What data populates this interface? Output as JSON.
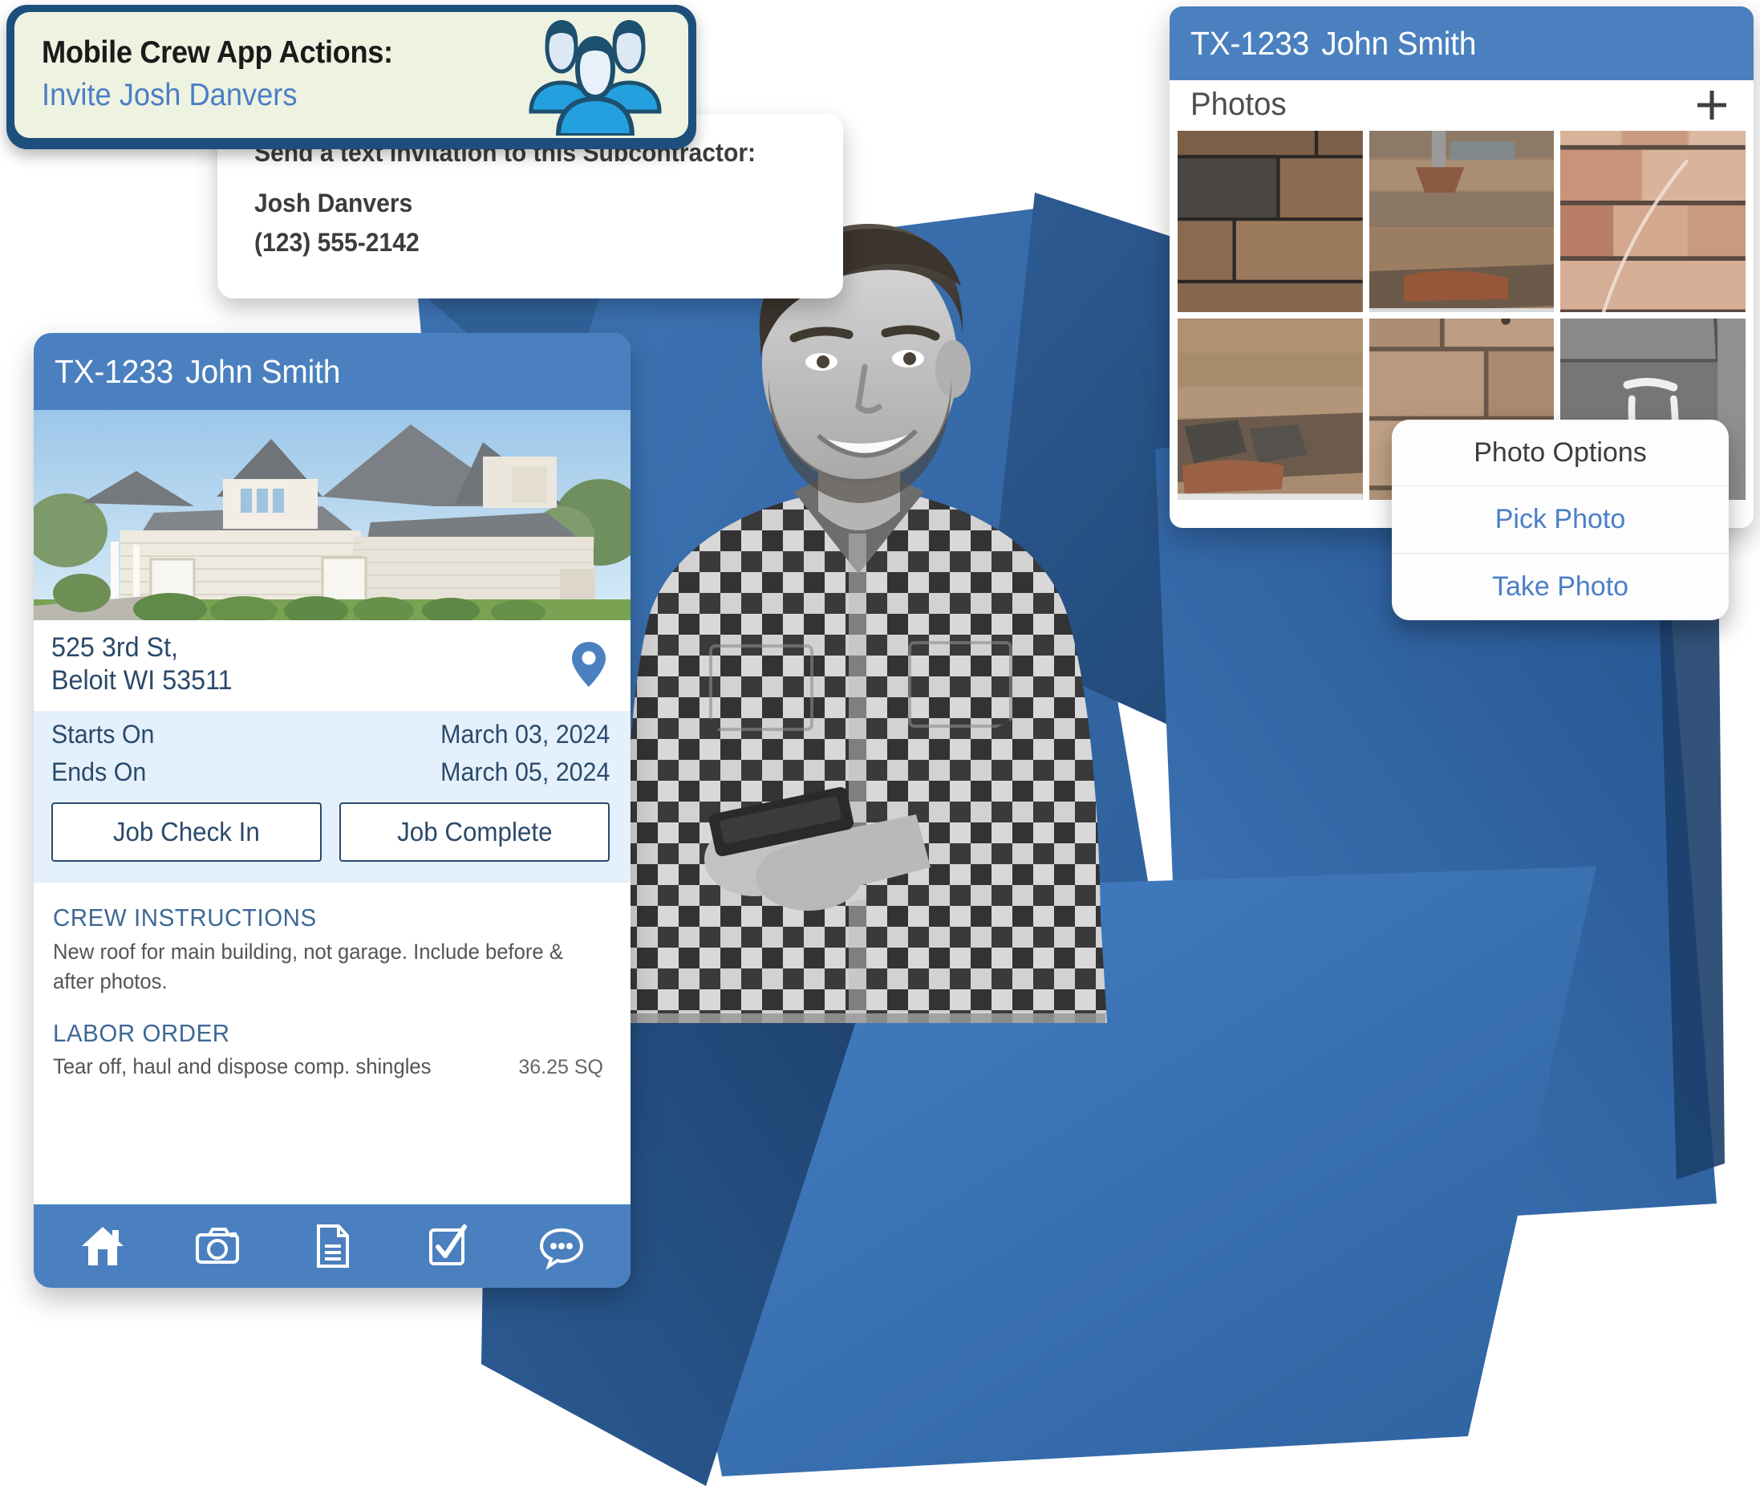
{
  "action_badge": {
    "title": "Mobile Crew App Actions:",
    "link": "Invite Josh Danvers",
    "icon": "crew-people-icon"
  },
  "invite_card": {
    "heading": "Send a text invitation to this Subcontractor:",
    "name": "Josh Danvers",
    "phone": "(123) 555-2142"
  },
  "job_card": {
    "header": {
      "job_id": "TX-1233",
      "customer": "John Smith"
    },
    "address": {
      "line1": "525 3rd St,",
      "line2": "Beloit WI 53511",
      "pin_icon": "map-pin-icon"
    },
    "dates": [
      {
        "label": "Starts On",
        "value": "March 03, 2024"
      },
      {
        "label": "Ends On",
        "value": "March 05, 2024"
      }
    ],
    "buttons": {
      "check_in": "Job Check In",
      "complete": "Job Complete"
    },
    "crew_instructions": {
      "title": "CREW INSTRUCTIONS",
      "body": "New roof for main building, not garage. Include before & after photos."
    },
    "labor_order": {
      "title": "LABOR ORDER",
      "items": [
        {
          "description": "Tear off, haul and dispose comp. shingles",
          "quantity": "36.25 SQ"
        }
      ]
    },
    "nav": [
      {
        "name": "home-icon",
        "label": "Home"
      },
      {
        "name": "camera-icon",
        "label": "Photos"
      },
      {
        "name": "document-icon",
        "label": "Documents"
      },
      {
        "name": "checklist-icon",
        "label": "Tasks"
      },
      {
        "name": "chat-icon",
        "label": "Messages"
      }
    ]
  },
  "photos_card": {
    "header": {
      "job_id": "TX-1233",
      "customer": "John Smith"
    },
    "section_label": "Photos",
    "add_icon": "plus-icon",
    "thumbnails": [
      {
        "alt": "Brown architectural shingles with dark streak"
      },
      {
        "alt": "Damaged shingles around roof vent pipe"
      },
      {
        "alt": "Tan shingles with chalk circle markings"
      },
      {
        "alt": "Torn off shingles exposing decking at eave"
      },
      {
        "alt": "Weathered tan shingles with nail pops"
      },
      {
        "alt": "Dark gray shingle with chalk mark"
      }
    ]
  },
  "photo_options": {
    "title": "Photo Options",
    "actions": [
      "Pick Photo",
      "Take Photo"
    ]
  },
  "colors": {
    "header_blue": "#4a80bf",
    "deep_navy": "#1d4f7c",
    "badge_green": "#eef3e1",
    "link_blue": "#4c7ec4",
    "text_navy": "#2b4a6b",
    "pale_blue": "#e4f0fb",
    "action_blue": "#4a7fc9"
  }
}
